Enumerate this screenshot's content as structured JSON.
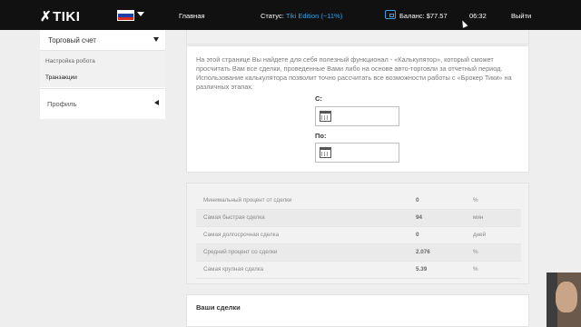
{
  "header": {
    "logo_mark": "✗",
    "logo_text": "TIKI",
    "nav_home": "Главная",
    "status_label": "Статус:",
    "status_edition": "Tiki Edition (~11%)",
    "balance": "Баланс: $77.57",
    "time": "06:32",
    "logout": "Выйти",
    "icons": [
      "flag-ru-icon",
      "chevron-down-icon",
      "wallet-icon"
    ],
    "flag_colors": [
      "#ffffff",
      "#1c3fa8",
      "#d52b1e"
    ]
  },
  "sidebar": {
    "trade_account": "Торговый счет",
    "robot_settings": "Настройка робота",
    "transactions": "Транзакции",
    "profile": "Профиль"
  },
  "calculator": {
    "intro": "На этой странице Вы найдете для себя полезный функционал - «Калькулятор», который сможет просчитать Вам все сделки, проведенные Вами либо на основе авто-торговли за отчетный период. Использование калькулятора позволит точно рассчитать все возможности работы с «Брокер Тики» на различных этапах.",
    "from_label": "С:",
    "to_label": "По:",
    "from_value": "",
    "to_value": ""
  },
  "stats": [
    {
      "label": "Минимальный процент от сделки",
      "value": "0",
      "unit": "%"
    },
    {
      "label": "Самая быстрая сделка",
      "value": "94",
      "unit": "мин"
    },
    {
      "label": "Самая долгосрочная сделка",
      "value": "0",
      "unit": "дней"
    },
    {
      "label": "Средний процент со сделки",
      "value": "2.076",
      "unit": "%"
    },
    {
      "label": "Самая крупная сделка",
      "value": "5.39",
      "unit": "%"
    }
  ],
  "deals": {
    "title": "Ваши сделки"
  }
}
